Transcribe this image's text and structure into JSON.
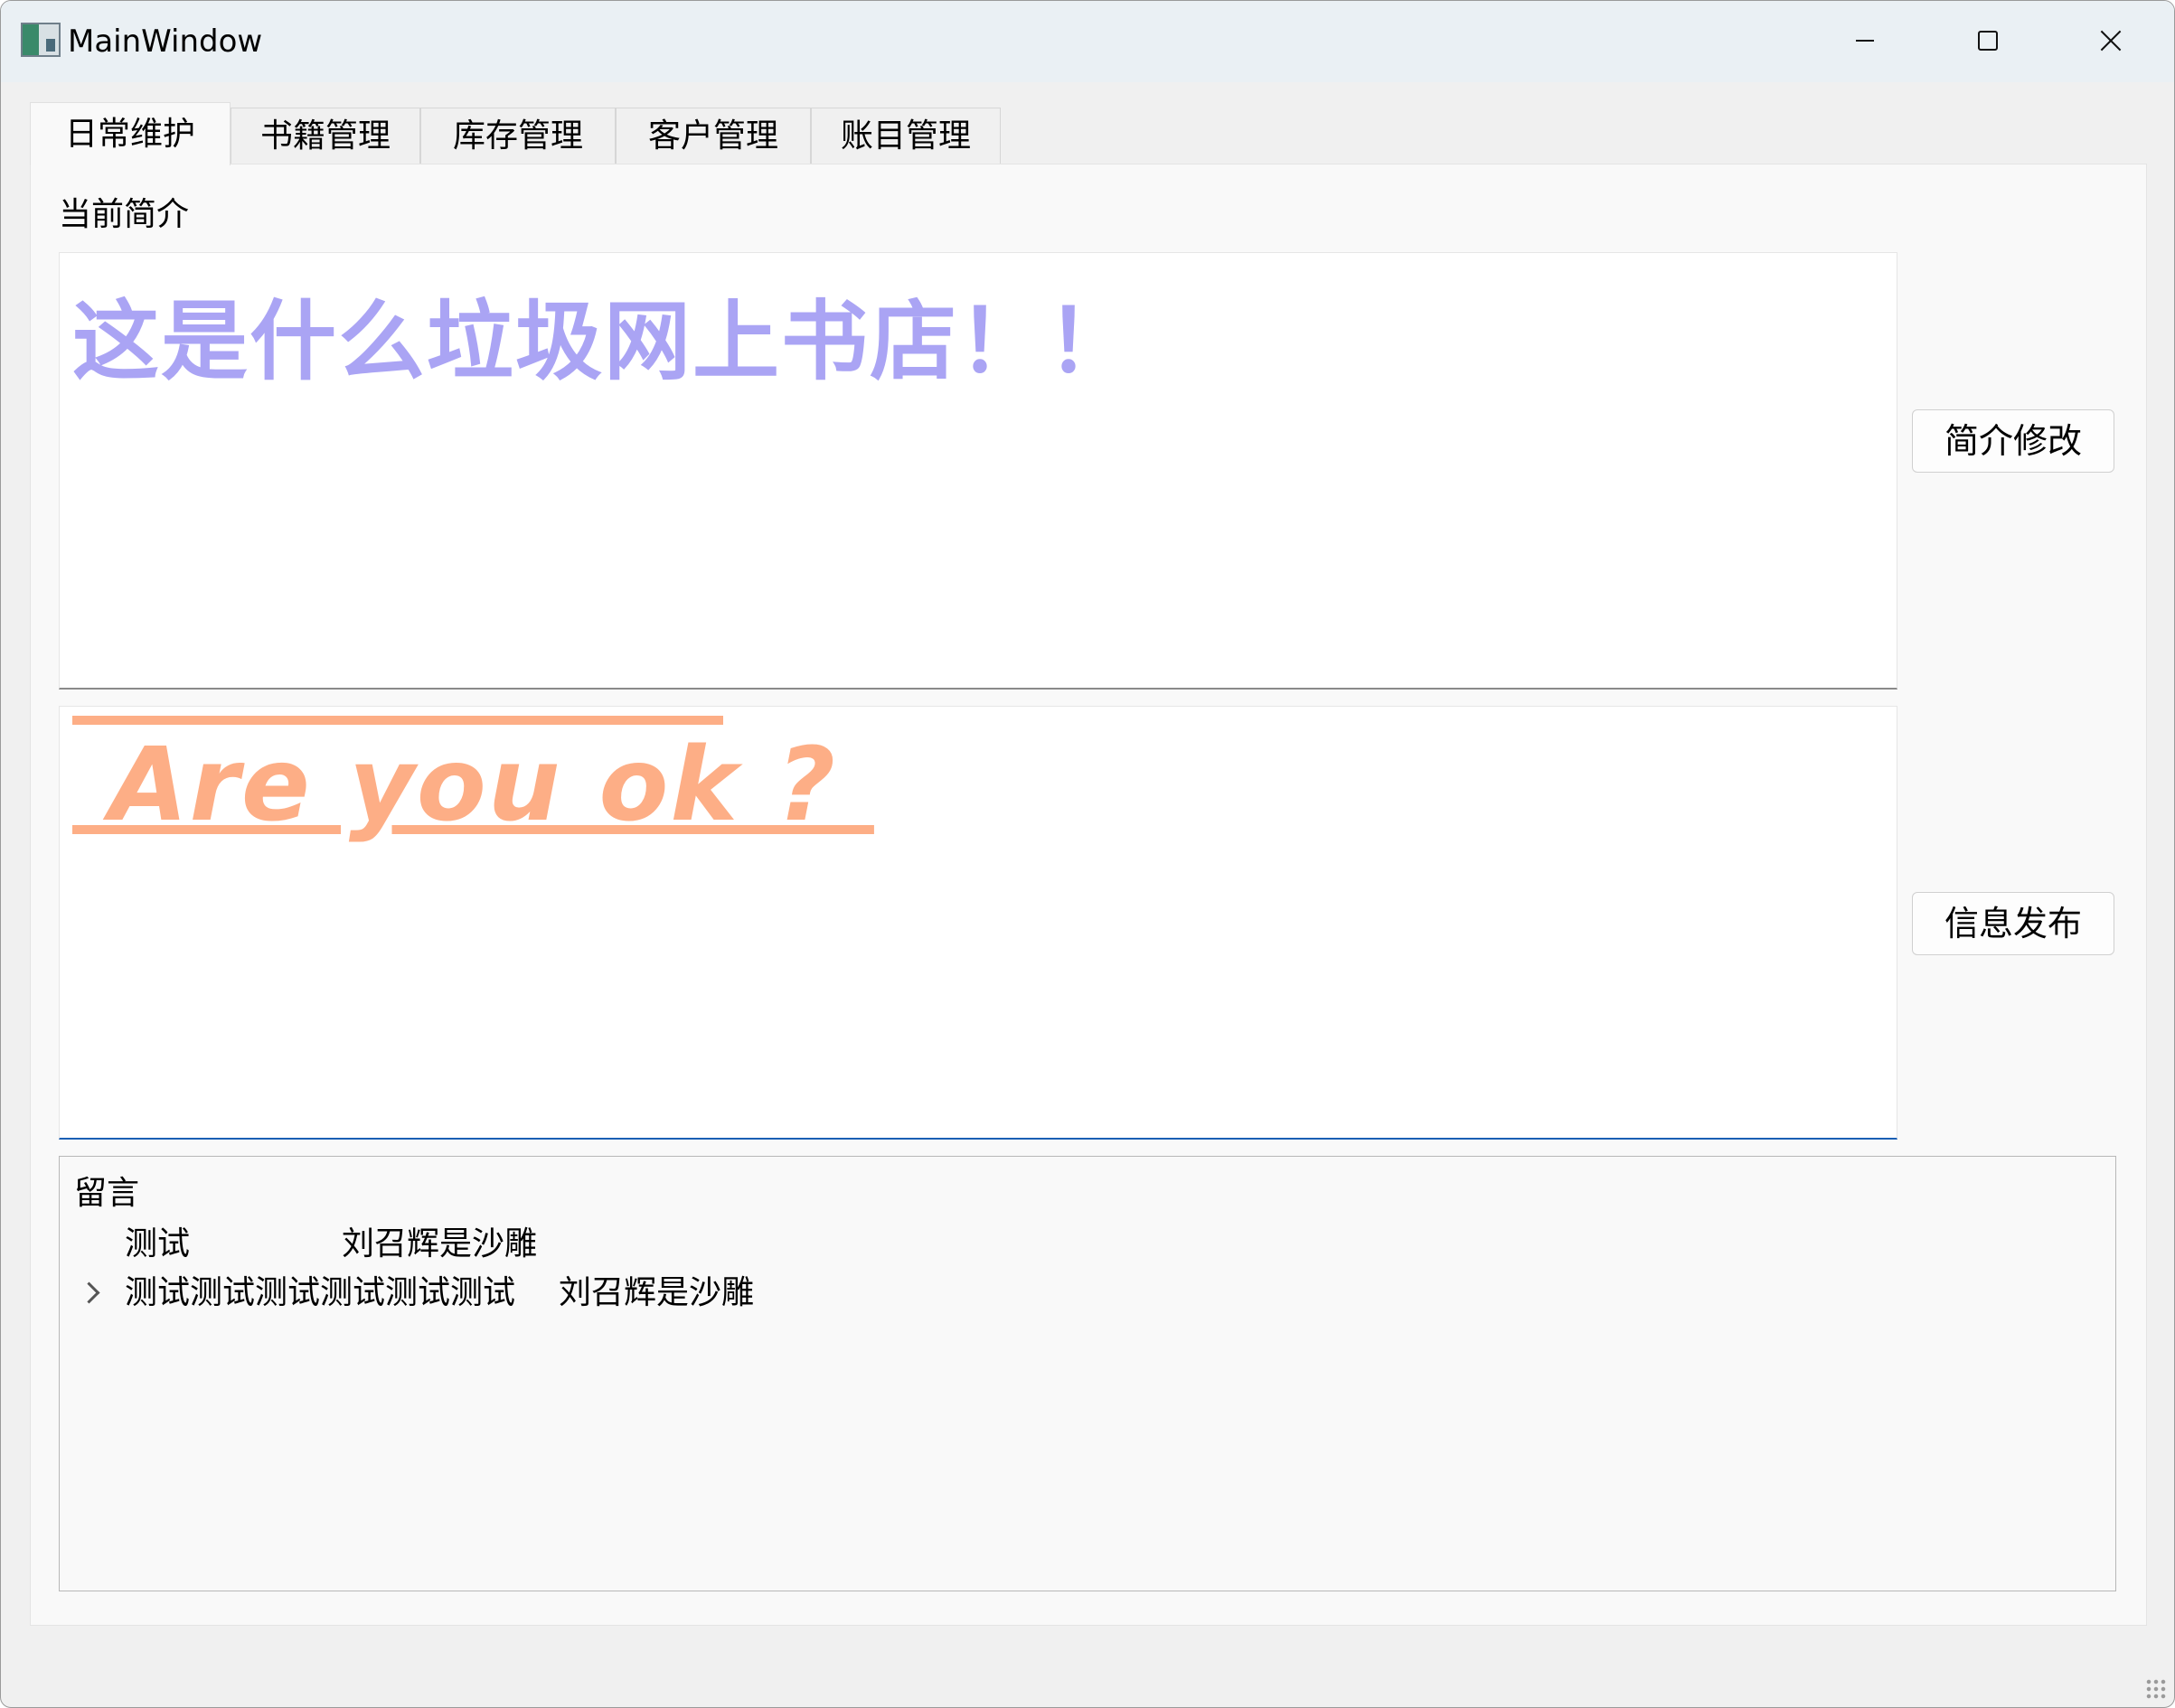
{
  "window": {
    "title": "MainWindow",
    "controls": [
      "minimize",
      "maximize",
      "close"
    ]
  },
  "tabs": [
    {
      "label": "日常维护",
      "active": true
    },
    {
      "label": "书籍管理",
      "active": false
    },
    {
      "label": "库存管理",
      "active": false
    },
    {
      "label": "客户管理",
      "active": false
    },
    {
      "label": "账目管理",
      "active": false
    }
  ],
  "daily": {
    "intro_label": "当前简介",
    "intro_text": "这是什么垃圾网上书店！！",
    "intro_color": "#aaa4f4",
    "info_text": " Are you ok ? ",
    "info_color": "#fdae86",
    "edit_button": "简介修改",
    "publish_button": "信息发布",
    "messages": {
      "title": "留言",
      "rows": [
        {
          "content": "测试",
          "author": "刘召辉是沙雕",
          "expandable": false
        },
        {
          "content": "测试测试测试测试测试测试",
          "author": "刘召辉是沙雕",
          "expandable": true
        }
      ]
    }
  }
}
